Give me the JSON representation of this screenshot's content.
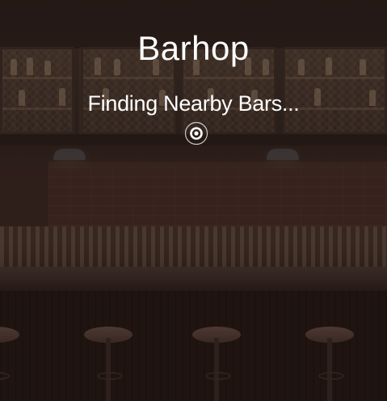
{
  "app": {
    "title": "Barhop",
    "status_text": "Finding Nearby Bars..."
  },
  "icons": {
    "locate": "location-target-icon"
  },
  "colors": {
    "text": "#ffffff",
    "overlay": "#1c1412"
  }
}
